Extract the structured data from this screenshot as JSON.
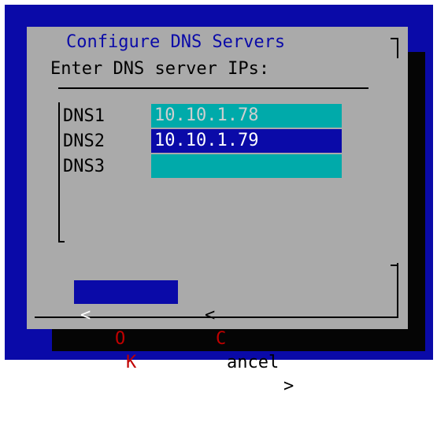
{
  "dialog": {
    "title": "Configure DNS Servers",
    "prompt": "Enter DNS server IPs:"
  },
  "fields": [
    {
      "label": "DNS1",
      "value": "10.10.1.78"
    },
    {
      "label": "DNS2",
      "value": "10.10.1.79"
    },
    {
      "label": "DNS3",
      "value": ""
    }
  ],
  "buttons": {
    "ok": {
      "left": "<",
      "hotkey": "O",
      "rest": "K",
      "right": ">"
    },
    "cancel": {
      "left": "<",
      "hotkey": "C",
      "rest": "ancel",
      "right": ">"
    }
  },
  "colors": {
    "screen_bg": "#0a0aa8",
    "dialog_bg": "#aaaaaa",
    "field_bg": "#00aaaa",
    "field_active_bg": "#0a0aa8",
    "hotkey": "#c00000"
  }
}
